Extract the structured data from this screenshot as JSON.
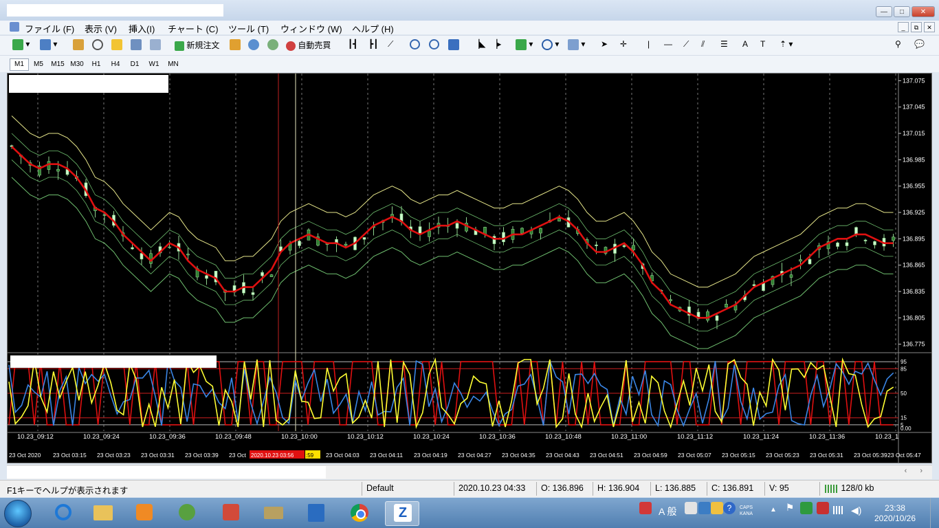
{
  "menu": {
    "items": [
      "ファイル (F)",
      "表示 (V)",
      "挿入(I)",
      "チャート (C)",
      "ツール (T)",
      "ウィンドウ (W)",
      "ヘルプ (H)"
    ]
  },
  "toolbar": {
    "new_order": "新規注文",
    "auto_trade": "自動売買"
  },
  "timeframes": [
    "M1",
    "M5",
    "M15",
    "M30",
    "H1",
    "H4",
    "D1",
    "W1",
    "MN"
  ],
  "chart_data": [
    {
      "type": "candlestick",
      "y_ticks": [
        "137.075",
        "137.045",
        "137.015",
        "136.985",
        "136.955",
        "136.925",
        "136.895",
        "136.865",
        "136.835",
        "136.805",
        "136.775"
      ],
      "ylim": [
        136.77,
        137.08
      ],
      "moving_average_close": [
        137.0,
        136.99,
        136.98,
        136.975,
        136.98,
        136.98,
        136.975,
        136.965,
        136.95,
        136.93,
        136.925,
        136.915,
        136.9,
        136.89,
        136.88,
        136.87,
        136.88,
        136.89,
        136.885,
        136.87,
        136.86,
        136.855,
        136.85,
        136.835,
        136.835,
        136.84,
        136.84,
        136.85,
        136.86,
        136.88,
        136.89,
        136.895,
        136.9,
        136.895,
        136.89,
        136.89,
        136.885,
        136.89,
        136.9,
        136.91,
        136.915,
        136.92,
        136.915,
        136.905,
        136.9,
        136.905,
        136.91,
        136.91,
        136.915,
        136.91,
        136.905,
        136.9,
        136.895,
        136.895,
        136.9,
        136.9,
        136.905,
        136.91,
        136.915,
        136.92,
        136.915,
        136.905,
        136.89,
        136.88,
        136.88,
        136.885,
        136.89,
        136.88,
        136.865,
        136.845,
        136.835,
        136.82,
        136.815,
        136.81,
        136.805,
        136.805,
        136.81,
        136.815,
        136.82,
        136.83,
        136.84,
        136.845,
        136.85,
        136.855,
        136.86,
        136.865,
        136.875,
        136.885,
        136.89,
        136.895,
        136.895,
        136.9,
        136.9,
        136.895,
        136.89,
        136.89
      ],
      "sell_price": "136.891",
      "indicator_levels": [
        "95",
        "85",
        "50",
        "15",
        "5",
        "0.00"
      ]
    }
  ],
  "subwindow_times": [
    "10.23_09:12",
    "10.23_09:24",
    "10.23_09:36",
    "10.23_09:48",
    "10.23_10:00",
    "10.23_10:12",
    "10.23_10:24",
    "10.23_10:36",
    "10.23_10:48",
    "10.23_11:00",
    "10.23_11:12",
    "10.23_11:24",
    "10.23_11:36",
    "10.23_1"
  ],
  "time_axis": [
    "23 Oct 2020",
    "23 Oct 03:15",
    "23 Oct 03:23",
    "23 Oct 03:31",
    "23 Oct 03:39",
    "23 Oct",
    "2020.10.23 03:56",
    ":59",
    "23 Oct 04:03",
    "23 Oct 04:11",
    "23 Oct 04:19",
    "23 Oct 04:27",
    "23 Oct 04:35",
    "23 Oct 04:43",
    "23 Oct 04:51",
    "23 Oct 04:59",
    "23 Oct 05:07",
    "23 Oct 05:15",
    "23 Oct 05:23",
    "23 Oct 05:31",
    "23 Oct 05:39",
    "23 Oct 05:47"
  ],
  "status": {
    "help": "F1キーでヘルプが表示されます",
    "profile": "Default",
    "datetime": "2020.10.23 04:33",
    "open": "O: 136.896",
    "high": "H: 136.904",
    "low": "L: 136.885",
    "close": "C: 136.891",
    "volume": "V: 95",
    "traffic": "128/0 kb"
  },
  "taskbar": {
    "ime": "A 般",
    "caps": "CAPS",
    "kana": "KANA",
    "time": "23:38",
    "date": "2020/10/26"
  },
  "colors": {
    "price_line": "#e01010",
    "bands_outer": "#e6e68a",
    "bands_inner": "#6fbf6f",
    "candle_bull": "#ccffcc",
    "candle_bear": "#2f7f2f",
    "stoch_main": "#ffff33",
    "stoch_signal": "#3a86e6",
    "signal_red": "#e01010"
  }
}
